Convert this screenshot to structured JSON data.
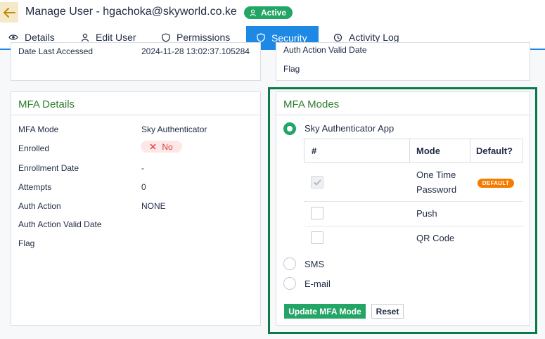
{
  "header": {
    "title": "Manage User - hgachoka@skyworld.co.ke",
    "status": "Active",
    "back_icon": "arrow-left-icon"
  },
  "tabs": [
    {
      "label": "Details",
      "icon": "eye-icon",
      "active": false
    },
    {
      "label": "Edit User",
      "icon": "user-icon",
      "active": false
    },
    {
      "label": "Permissions",
      "icon": "shield-icon",
      "active": false
    },
    {
      "label": "Security",
      "icon": "shield-icon",
      "active": true
    },
    {
      "label": "Activity Log",
      "icon": "history-icon",
      "active": false
    }
  ],
  "top_left_card": {
    "label": "Date Last Accessed",
    "value": "2024-11-28 13:02:37.105284"
  },
  "top_right_card": {
    "label_partial": "Auth Action Valid Date",
    "flag_label": "Flag"
  },
  "mfa_details": {
    "title": "MFA Details",
    "rows": [
      {
        "label": "MFA Mode",
        "value": "Sky Authenticator"
      },
      {
        "label": "Enrolled",
        "value": "No"
      },
      {
        "label": "Enrollment Date",
        "value": "-"
      },
      {
        "label": "Attempts",
        "value": "0"
      },
      {
        "label": "Auth Action",
        "value": "NONE"
      },
      {
        "label": "Auth Action Valid Date",
        "value": ""
      },
      {
        "label": "Flag",
        "value": ""
      }
    ]
  },
  "mfa_modes": {
    "title": "MFA Modes",
    "options": [
      {
        "label": "Sky Authenticator App",
        "selected": true
      },
      {
        "label": "SMS",
        "selected": false
      },
      {
        "label": "E-mail",
        "selected": false
      }
    ],
    "table": {
      "headers": [
        "#",
        "Mode",
        "Default?"
      ],
      "rows": [
        {
          "mode": "One Time Password",
          "checked": true,
          "default": "DEFAULT"
        },
        {
          "mode": "Push",
          "checked": false,
          "default": ""
        },
        {
          "mode": "QR Code",
          "checked": false,
          "default": ""
        }
      ]
    },
    "update_button": "Update MFA Mode",
    "reset_button": "Reset"
  },
  "colors": {
    "accent": "#1e88e5",
    "success": "#22a565",
    "title_green": "#2e7d32",
    "danger": "#e53935",
    "badge_orange": "#f57c00",
    "frame_green": "#0b7a4a"
  }
}
